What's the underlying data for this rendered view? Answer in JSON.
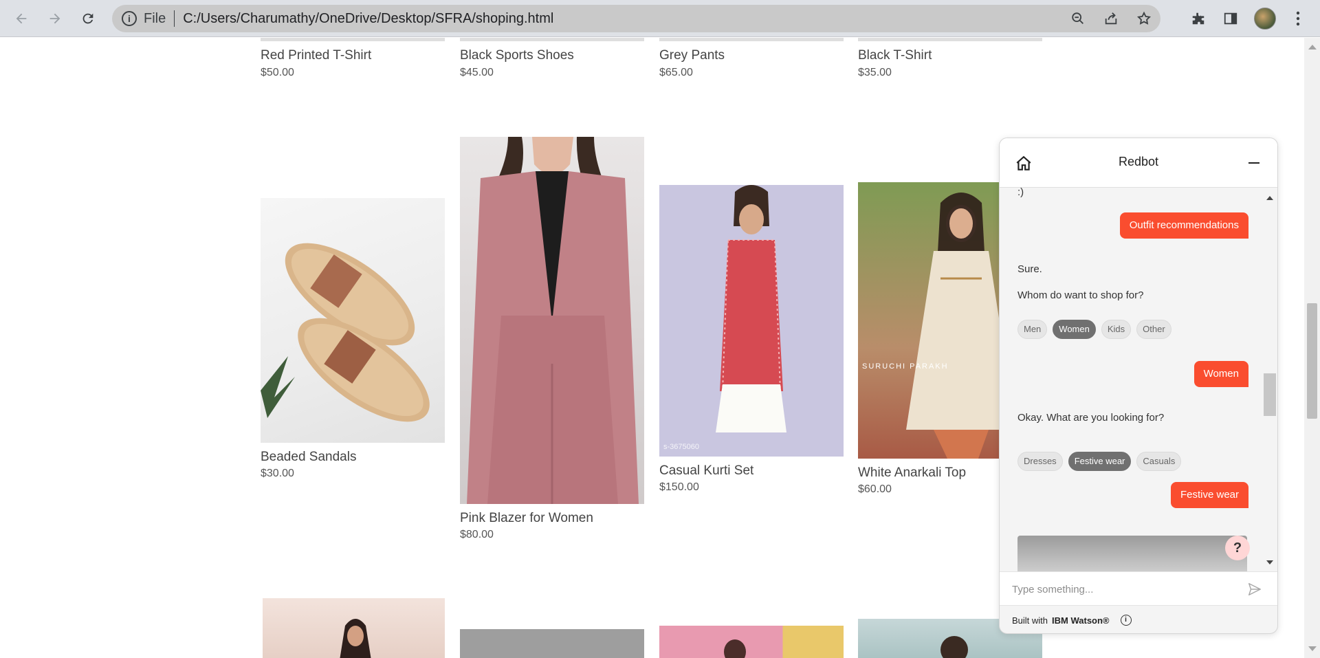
{
  "browser": {
    "url_scheme_label": "File",
    "url": "C:/Users/Charumathy/OneDrive/Desktop/SFRA/shoping.html",
    "icons": [
      "back-icon",
      "forward-icon",
      "reload-icon",
      "info-icon",
      "zoom-out-icon",
      "share-icon",
      "star-icon",
      "extensions-icon",
      "side-panel-icon",
      "profile-avatar",
      "menu-icon"
    ]
  },
  "products_row1": [
    {
      "name": "Red Printed T-Shirt",
      "price": "$50.00"
    },
    {
      "name": "Black Sports Shoes",
      "price": "$45.00"
    },
    {
      "name": "Grey Pants",
      "price": "$65.00"
    },
    {
      "name": "Black T-Shirt",
      "price": "$35.00"
    }
  ],
  "products_row2": [
    {
      "name": "Beaded Sandals",
      "price": "$30.00"
    },
    {
      "name": "Pink Blazer for Women",
      "price": "$80.00"
    },
    {
      "name": "Casual Kurti Set",
      "price": "$150.00",
      "watermark": "s-3675060"
    },
    {
      "name": "White Anarkali Top",
      "price": "$60.00",
      "watermark": "SURUCHI PARAKH"
    }
  ],
  "chat": {
    "title": "Redbot",
    "messages": {
      "bot_top_text": ":)",
      "user_1": "Outfit recommendations",
      "bot_1a": "Sure.",
      "bot_1b": "Whom do want to shop for?",
      "chips_1": [
        {
          "label": "Men",
          "selected": false
        },
        {
          "label": "Women",
          "selected": true
        },
        {
          "label": "Kids",
          "selected": false
        },
        {
          "label": "Other",
          "selected": false
        }
      ],
      "user_2": "Women",
      "bot_2": "Okay. What are you looking for?",
      "chips_2": [
        {
          "label": "Dresses",
          "selected": false
        },
        {
          "label": "Festive wear",
          "selected": true
        },
        {
          "label": "Casuals",
          "selected": false
        }
      ],
      "user_3": "Festive wear"
    },
    "help_label": "?",
    "input_placeholder": "Type something...",
    "footer_prefix": "Built with",
    "footer_brand": "IBM Watson®",
    "accent_color": "#fa4d2f"
  }
}
